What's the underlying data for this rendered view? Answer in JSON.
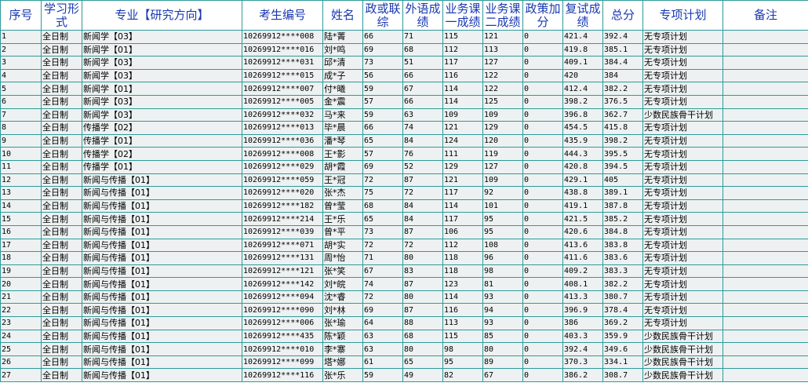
{
  "table": {
    "headers": [
      "序号",
      "学习形式",
      "专业【研究方向】",
      "考生编号",
      "姓名",
      "政或联综",
      "外语成绩",
      "业务课一成绩",
      "业务课二成绩",
      "政策加分",
      "复试成绩",
      "总分",
      "专项计划",
      "备注"
    ],
    "rows": [
      [
        "1",
        "全日制",
        "新闻学【03】",
        "10269912****008",
        "陆*菁",
        "66",
        "71",
        "115",
        "121",
        "0",
        "421.4",
        "392.4",
        "无专项计划",
        ""
      ],
      [
        "2",
        "全日制",
        "新闻学【01】",
        "10269912****016",
        "刘*鸣",
        "69",
        "68",
        "112",
        "113",
        "0",
        "419.8",
        "385.1",
        "无专项计划",
        ""
      ],
      [
        "3",
        "全日制",
        "新闻学【03】",
        "10269912****031",
        "邱*清",
        "73",
        "51",
        "117",
        "127",
        "0",
        "409.1",
        "384.4",
        "无专项计划",
        ""
      ],
      [
        "4",
        "全日制",
        "新闻学【03】",
        "10269912****015",
        "成*子",
        "56",
        "66",
        "116",
        "122",
        "0",
        "420",
        "384",
        "无专项计划",
        ""
      ],
      [
        "5",
        "全日制",
        "新闻学【01】",
        "10269912****007",
        "付*曦",
        "59",
        "67",
        "114",
        "122",
        "0",
        "412.4",
        "382.2",
        "无专项计划",
        ""
      ],
      [
        "6",
        "全日制",
        "新闻学【03】",
        "10269912****005",
        "金*震",
        "57",
        "66",
        "114",
        "125",
        "0",
        "398.2",
        "376.5",
        "无专项计划",
        ""
      ],
      [
        "7",
        "全日制",
        "新闻学【03】",
        "10269912****032",
        "马*来",
        "59",
        "63",
        "109",
        "109",
        "0",
        "396.8",
        "362.7",
        "少数民族骨干计划",
        ""
      ],
      [
        "8",
        "全日制",
        "传播学【02】",
        "10269912****013",
        "毕*晨",
        "66",
        "74",
        "121",
        "129",
        "0",
        "454.5",
        "415.8",
        "无专项计划",
        ""
      ],
      [
        "9",
        "全日制",
        "传播学【01】",
        "10269912****036",
        "潘*琴",
        "65",
        "84",
        "124",
        "120",
        "0",
        "435.9",
        "398.2",
        "无专项计划",
        ""
      ],
      [
        "10",
        "全日制",
        "传播学【02】",
        "10269912****008",
        "王*影",
        "57",
        "76",
        "111",
        "119",
        "0",
        "444.3",
        "395.5",
        "无专项计划",
        ""
      ],
      [
        "11",
        "全日制",
        "传播学【01】",
        "10269912****029",
        "胡*霞",
        "69",
        "52",
        "129",
        "127",
        "0",
        "420.8",
        "394.5",
        "无专项计划",
        ""
      ],
      [
        "12",
        "全日制",
        "新闻与传播【01】",
        "10269912****059",
        "王*冠",
        "72",
        "87",
        "121",
        "109",
        "0",
        "429.1",
        "405",
        "无专项计划",
        ""
      ],
      [
        "13",
        "全日制",
        "新闻与传播【01】",
        "10269912****020",
        "张*杰",
        "75",
        "72",
        "117",
        "92",
        "0",
        "438.8",
        "389.1",
        "无专项计划",
        ""
      ],
      [
        "14",
        "全日制",
        "新闻与传播【01】",
        "10269912****182",
        "曾*莹",
        "68",
        "84",
        "114",
        "101",
        "0",
        "419.1",
        "387.8",
        "无专项计划",
        ""
      ],
      [
        "15",
        "全日制",
        "新闻与传播【01】",
        "10269912****214",
        "王*乐",
        "65",
        "84",
        "117",
        "95",
        "0",
        "421.5",
        "385.2",
        "无专项计划",
        ""
      ],
      [
        "16",
        "全日制",
        "新闻与传播【01】",
        "10269912****039",
        "曾*平",
        "73",
        "87",
        "106",
        "95",
        "0",
        "420.6",
        "384.8",
        "无专项计划",
        ""
      ],
      [
        "17",
        "全日制",
        "新闻与传播【01】",
        "10269912****071",
        "胡*实",
        "72",
        "72",
        "112",
        "108",
        "0",
        "413.6",
        "383.8",
        "无专项计划",
        ""
      ],
      [
        "18",
        "全日制",
        "新闻与传播【01】",
        "10269912****131",
        "周*怡",
        "71",
        "80",
        "118",
        "96",
        "0",
        "411.6",
        "383.6",
        "无专项计划",
        ""
      ],
      [
        "19",
        "全日制",
        "新闻与传播【01】",
        "10269912****121",
        "张*笑",
        "67",
        "83",
        "118",
        "98",
        "0",
        "409.2",
        "383.3",
        "无专项计划",
        ""
      ],
      [
        "20",
        "全日制",
        "新闻与传播【01】",
        "10269912****142",
        "刘*皖",
        "74",
        "87",
        "123",
        "81",
        "0",
        "408.1",
        "382.2",
        "无专项计划",
        ""
      ],
      [
        "21",
        "全日制",
        "新闻与传播【01】",
        "10269912****094",
        "沈*睿",
        "72",
        "80",
        "114",
        "93",
        "0",
        "413.3",
        "380.7",
        "无专项计划",
        ""
      ],
      [
        "22",
        "全日制",
        "新闻与传播【01】",
        "10269912****090",
        "刘*林",
        "69",
        "87",
        "116",
        "94",
        "0",
        "396.9",
        "378.4",
        "无专项计划",
        ""
      ],
      [
        "23",
        "全日制",
        "新闻与传播【01】",
        "10269912****006",
        "张*瑜",
        "64",
        "88",
        "113",
        "93",
        "0",
        "386",
        "369.2",
        "无专项计划",
        ""
      ],
      [
        "24",
        "全日制",
        "新闻与传播【01】",
        "10269912****435",
        "陈*颖",
        "63",
        "68",
        "115",
        "85",
        "0",
        "403.3",
        "359.9",
        "少数民族骨干计划",
        ""
      ],
      [
        "25",
        "全日制",
        "新闻与传播【01】",
        "10269912****010",
        "李*寨",
        "63",
        "80",
        "98",
        "80",
        "0",
        "392.4",
        "349.6",
        "少数民族骨干计划",
        ""
      ],
      [
        "26",
        "全日制",
        "新闻与传播【01】",
        "10269912****099",
        "塔*娜",
        "61",
        "65",
        "95",
        "89",
        "0",
        "370.3",
        "334.1",
        "少数民族骨干计划",
        ""
      ],
      [
        "27",
        "全日制",
        "新闻与传播【01】",
        "10269912****116",
        "张*乐",
        "59",
        "49",
        "82",
        "67",
        "0",
        "386.2",
        "308.7",
        "少数民族骨干计划",
        ""
      ]
    ]
  },
  "colors": {
    "header_text": "#1838b0",
    "border": "#2f9a9a",
    "row_background": "#eef1f1"
  }
}
